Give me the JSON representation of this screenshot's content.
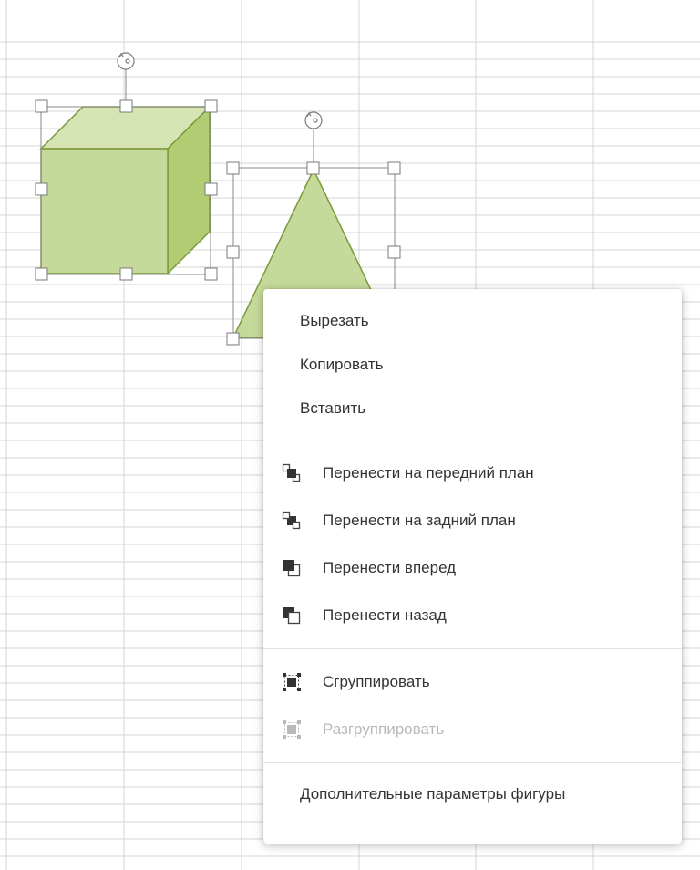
{
  "context_menu": {
    "cut": "Вырезать",
    "copy": "Копировать",
    "paste": "Вставить",
    "bring_to_front": "Перенести на передний план",
    "send_to_back": "Перенести на задний план",
    "bring_forward": "Перенести вперед",
    "send_backward": "Перенести назад",
    "group": "Сгруппировать",
    "ungroup": "Разгруппировать",
    "shape_settings": "Дополнительные параметры фигуры"
  },
  "icons": {
    "bring_to_front": "bring-to-front-icon",
    "send_to_back": "send-to-back-icon",
    "bring_forward": "bring-forward-icon",
    "send_backward": "send-backward-icon",
    "group": "group-icon",
    "ungroup": "ungroup-icon",
    "rotate": "rotate-handle-icon"
  },
  "shapes": {
    "cube": "cube-shape",
    "triangle": "triangle-shape",
    "fill": "#c5d99a",
    "fill_light": "#d6e4b4",
    "fill_dark": "#b1cc73",
    "stroke": "#7a9a3c"
  },
  "colors": {
    "grid_line": "#d4d4d4",
    "handle_border": "#7a7a7a",
    "menu_text": "#333333",
    "menu_disabled": "#b9b9b9"
  }
}
